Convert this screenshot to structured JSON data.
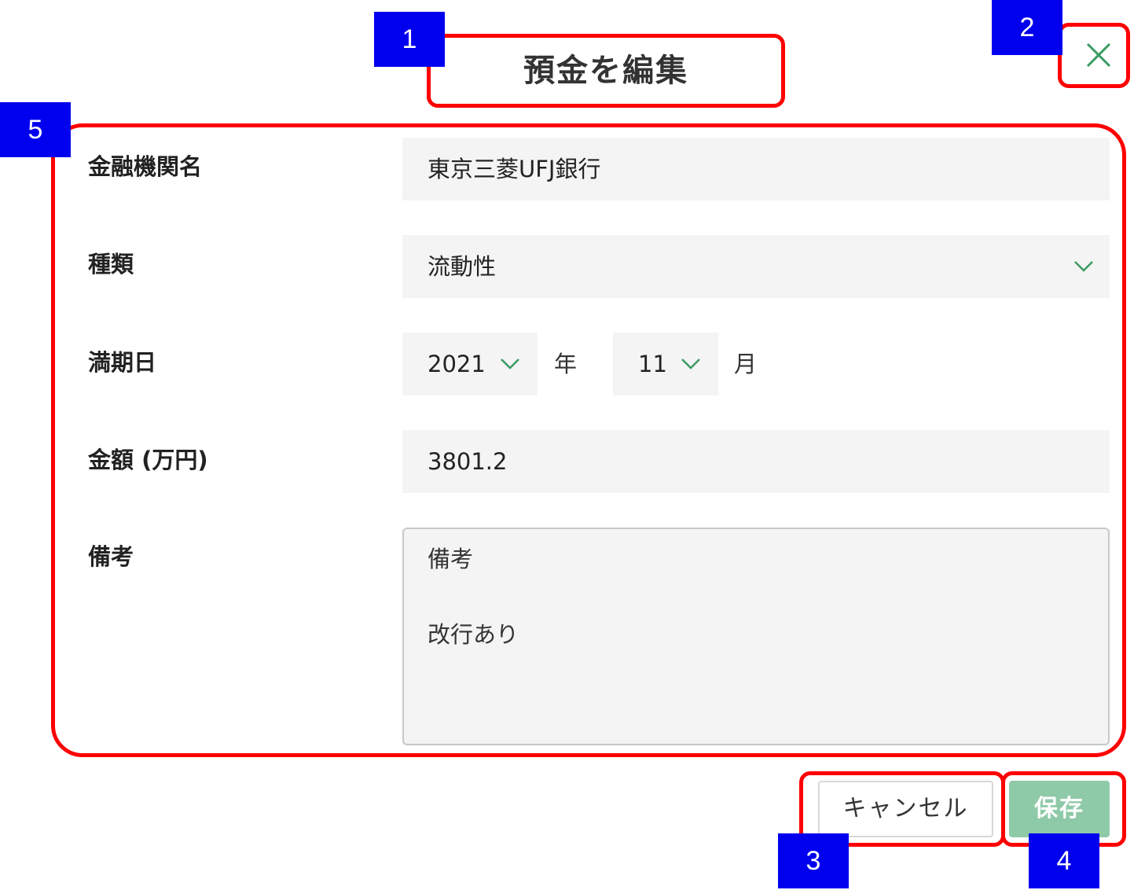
{
  "dialog": {
    "title": "預金を編集"
  },
  "form": {
    "institution": {
      "label": "金融機関名",
      "value": "東京三菱UFJ銀行"
    },
    "type": {
      "label": "種類",
      "value": "流動性"
    },
    "maturity": {
      "label": "満期日",
      "year_value": "2021",
      "year_unit": "年",
      "month_value": "11",
      "month_unit": "月"
    },
    "amount": {
      "label": "金額 (万円)",
      "value": "3801.2"
    },
    "notes": {
      "label": "備考",
      "value": "備考\n\n改行あり"
    }
  },
  "buttons": {
    "cancel_label": "キャンセル",
    "save_label": "保存"
  },
  "annotations": [
    "1",
    "2",
    "3",
    "4",
    "5"
  ],
  "colors": {
    "accent_green": "#3a9a62",
    "save_button_bg": "#8fcaa8",
    "field_bg": "#f4f4f4",
    "annotation_red": "#ff0000",
    "annotation_blue": "#0000ee"
  }
}
